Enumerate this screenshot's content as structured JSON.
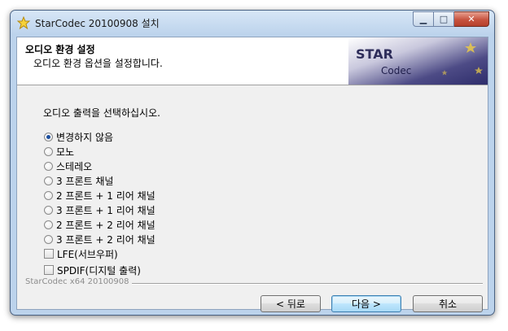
{
  "window": {
    "title": "StarCodec 20100908 설치"
  },
  "header": {
    "title": "오디오 환경 설정",
    "subtitle": "오디오 환경 옵션을 설정합니다.",
    "logo_line1": "STAR",
    "logo_line2": "Codec"
  },
  "main": {
    "prompt": "오디오 출력을 선택하십시오.",
    "radio_options": [
      {
        "label": "변경하지 않음",
        "selected": true
      },
      {
        "label": "모노",
        "selected": false
      },
      {
        "label": "스테레오",
        "selected": false
      },
      {
        "label": "3 프론트 채널",
        "selected": false
      },
      {
        "label": "2 프론트 + 1 리어 채널",
        "selected": false
      },
      {
        "label": "3 프론트 + 1 리어 채널",
        "selected": false
      },
      {
        "label": "2 프론트 + 2 리어 채널",
        "selected": false
      },
      {
        "label": "3 프론트 + 2 리어 채널",
        "selected": false
      }
    ],
    "checkboxes": [
      {
        "label": "LFE(서브우퍼)",
        "checked": false
      },
      {
        "label": "SPDIF(디지털 출력)",
        "checked": false
      }
    ]
  },
  "footer": {
    "brand": "StarCodec x64 20100908"
  },
  "buttons": {
    "back": "< 뒤로",
    "next": "다음 >",
    "cancel": "취소"
  },
  "colors": {
    "selected_radio": "#1c4f9e",
    "logo_bg": "#2e2d6b",
    "default_button_border": "#3c7fb1"
  }
}
